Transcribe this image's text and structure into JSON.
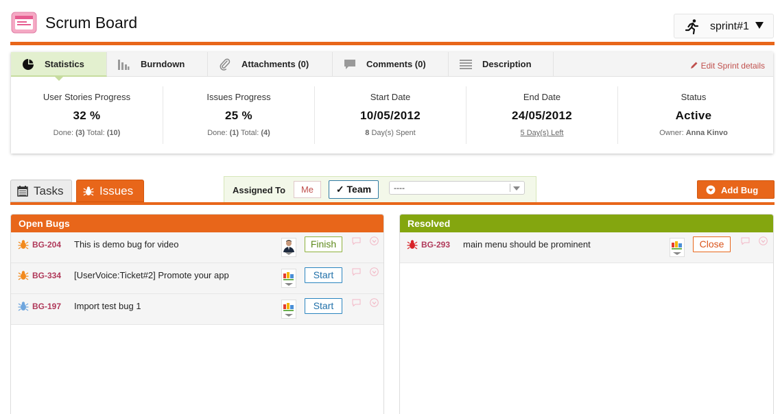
{
  "header": {
    "title": "Scrum Board",
    "sprint_label": "sprint#1"
  },
  "stats_tabs": {
    "items": [
      {
        "label": "Statistics",
        "icon": "pie-chart-icon",
        "active": true
      },
      {
        "label": "Burndown",
        "icon": "bar-chart-icon",
        "active": false
      },
      {
        "label": "Attachments (0)",
        "icon": "paperclip-icon",
        "active": false
      },
      {
        "label": "Comments (0)",
        "icon": "speech-bubble-icon",
        "active": false
      },
      {
        "label": "Description",
        "icon": "lines-icon",
        "active": false
      }
    ],
    "edit_link": "Edit Sprint details"
  },
  "stats": {
    "user_stories": {
      "title": "User Stories Progress",
      "value": "32 %",
      "done_label": "Done:",
      "done": "(3)",
      "total_label": "Total:",
      "total": "(10)"
    },
    "issues": {
      "title": "Issues Progress",
      "value": "25 %",
      "done_label": "Done:",
      "done": "(1)",
      "total_label": "Total:",
      "total": "(4)"
    },
    "start_date": {
      "title": "Start Date",
      "value": "10/05/2012",
      "spent_num": "8",
      "spent_label": "Day(s) Spent"
    },
    "end_date": {
      "title": "End Date",
      "value": "24/05/2012",
      "left": "5 Day(s) Left"
    },
    "status": {
      "title": "Status",
      "value": "Active",
      "owner_label": "Owner:",
      "owner": "Anna Kinvo"
    }
  },
  "toolbar": {
    "tasks_tab": "Tasks",
    "issues_tab": "Issues",
    "assigned_to_label": "Assigned To",
    "me_button": "Me",
    "team_button": "Team",
    "select_value": "----",
    "add_bug_button": "Add Bug"
  },
  "columns": {
    "open": {
      "title": "Open Bugs",
      "rows": [
        {
          "id": "BG-204",
          "title": "This is demo bug for video",
          "action": "Finish",
          "bug_color": "#f28a1e"
        },
        {
          "id": "BG-334",
          "title": "[UserVoice:Ticket#2] Promote your app",
          "action": "Start",
          "bug_color": "#f28a1e"
        },
        {
          "id": "BG-197",
          "title": "Import test bug 1",
          "action": "Start",
          "bug_color": "#6fa6de"
        }
      ]
    },
    "resolved": {
      "title": "Resolved",
      "rows": [
        {
          "id": "BG-293",
          "title": "main menu should be prominent",
          "action": "Close",
          "bug_color": "#d8242a"
        }
      ]
    }
  },
  "colors": {
    "accent_orange": "#e8661a",
    "resolved_green": "#84a60f",
    "bug_id_red": "#b0395a"
  }
}
